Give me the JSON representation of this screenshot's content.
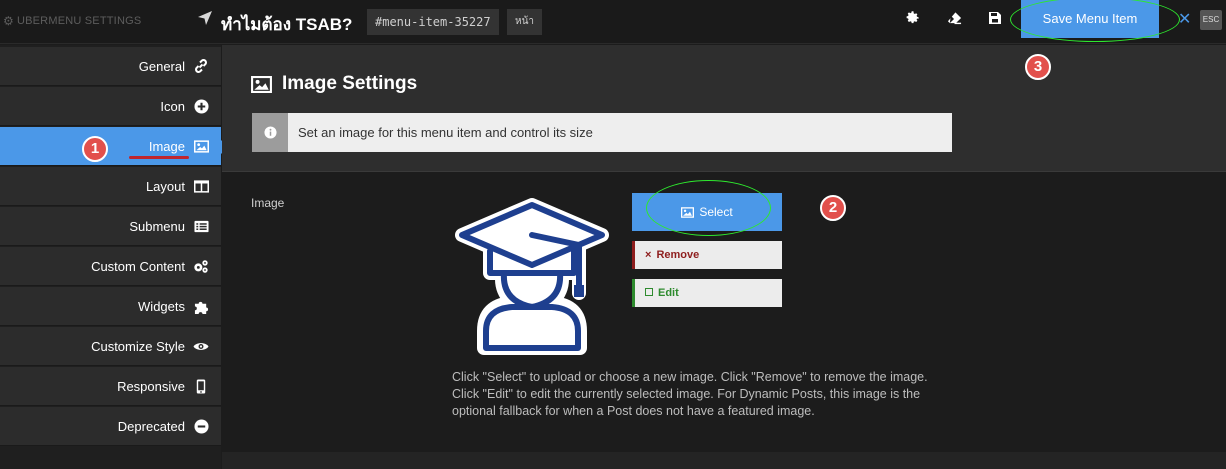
{
  "topbar": {
    "brand": "UBERMENU SETTINGS",
    "title": "ทำไมต้อง TSAB?",
    "item_id": "#menu-item-35227",
    "item_type": "หน้า",
    "save_label": "Save Menu Item",
    "esc_label": "ESC",
    "close_label": "✕"
  },
  "sidebar": {
    "items": [
      {
        "label": "General",
        "icon": "link-icon"
      },
      {
        "label": "Icon",
        "icon": "plus-circle-icon"
      },
      {
        "label": "Image",
        "icon": "image-icon",
        "active": true
      },
      {
        "label": "Layout",
        "icon": "columns-icon"
      },
      {
        "label": "Submenu",
        "icon": "list-icon"
      },
      {
        "label": "Custom Content",
        "icon": "gears-icon"
      },
      {
        "label": "Widgets",
        "icon": "puzzle-icon"
      },
      {
        "label": "Customize Style",
        "icon": "eye-icon"
      },
      {
        "label": "Responsive",
        "icon": "mobile-icon"
      },
      {
        "label": "Deprecated",
        "icon": "minus-circle-icon"
      }
    ]
  },
  "annotations": {
    "badge1": "1",
    "badge2": "2",
    "badge3": "3"
  },
  "main": {
    "section_title": "Image Settings",
    "info_text": "Set an image for this menu item and control its size",
    "field_label": "Image",
    "select_label": "Select",
    "remove_label": "Remove",
    "edit_label": "Edit",
    "description": "Click \"Select\" to upload or choose a new image. Click \"Remove\" to remove the image. Click \"Edit\" to edit the currently selected image. For Dynamic Posts, this image is the optional fallback for when a Post does not have a featured image."
  },
  "colors": {
    "accent": "#4b98e8",
    "annotation_green": "#2ee82e",
    "badge_red": "#e2504c",
    "remove_red": "#8e1d1d",
    "edit_green": "#2e8b2e",
    "graduate_icon_blue": "#1e3f8f"
  }
}
